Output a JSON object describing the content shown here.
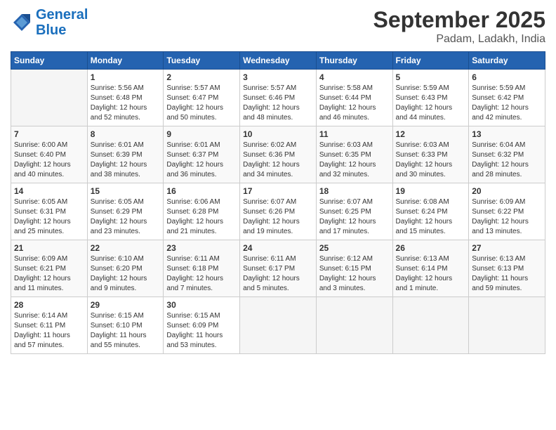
{
  "header": {
    "logo_line1": "General",
    "logo_line2": "Blue",
    "month": "September 2025",
    "location": "Padam, Ladakh, India"
  },
  "weekdays": [
    "Sunday",
    "Monday",
    "Tuesday",
    "Wednesday",
    "Thursday",
    "Friday",
    "Saturday"
  ],
  "weeks": [
    [
      {
        "day": "",
        "info": ""
      },
      {
        "day": "1",
        "info": "Sunrise: 5:56 AM\nSunset: 6:48 PM\nDaylight: 12 hours\nand 52 minutes."
      },
      {
        "day": "2",
        "info": "Sunrise: 5:57 AM\nSunset: 6:47 PM\nDaylight: 12 hours\nand 50 minutes."
      },
      {
        "day": "3",
        "info": "Sunrise: 5:57 AM\nSunset: 6:46 PM\nDaylight: 12 hours\nand 48 minutes."
      },
      {
        "day": "4",
        "info": "Sunrise: 5:58 AM\nSunset: 6:44 PM\nDaylight: 12 hours\nand 46 minutes."
      },
      {
        "day": "5",
        "info": "Sunrise: 5:59 AM\nSunset: 6:43 PM\nDaylight: 12 hours\nand 44 minutes."
      },
      {
        "day": "6",
        "info": "Sunrise: 5:59 AM\nSunset: 6:42 PM\nDaylight: 12 hours\nand 42 minutes."
      }
    ],
    [
      {
        "day": "7",
        "info": "Sunrise: 6:00 AM\nSunset: 6:40 PM\nDaylight: 12 hours\nand 40 minutes."
      },
      {
        "day": "8",
        "info": "Sunrise: 6:01 AM\nSunset: 6:39 PM\nDaylight: 12 hours\nand 38 minutes."
      },
      {
        "day": "9",
        "info": "Sunrise: 6:01 AM\nSunset: 6:37 PM\nDaylight: 12 hours\nand 36 minutes."
      },
      {
        "day": "10",
        "info": "Sunrise: 6:02 AM\nSunset: 6:36 PM\nDaylight: 12 hours\nand 34 minutes."
      },
      {
        "day": "11",
        "info": "Sunrise: 6:03 AM\nSunset: 6:35 PM\nDaylight: 12 hours\nand 32 minutes."
      },
      {
        "day": "12",
        "info": "Sunrise: 6:03 AM\nSunset: 6:33 PM\nDaylight: 12 hours\nand 30 minutes."
      },
      {
        "day": "13",
        "info": "Sunrise: 6:04 AM\nSunset: 6:32 PM\nDaylight: 12 hours\nand 28 minutes."
      }
    ],
    [
      {
        "day": "14",
        "info": "Sunrise: 6:05 AM\nSunset: 6:31 PM\nDaylight: 12 hours\nand 25 minutes."
      },
      {
        "day": "15",
        "info": "Sunrise: 6:05 AM\nSunset: 6:29 PM\nDaylight: 12 hours\nand 23 minutes."
      },
      {
        "day": "16",
        "info": "Sunrise: 6:06 AM\nSunset: 6:28 PM\nDaylight: 12 hours\nand 21 minutes."
      },
      {
        "day": "17",
        "info": "Sunrise: 6:07 AM\nSunset: 6:26 PM\nDaylight: 12 hours\nand 19 minutes."
      },
      {
        "day": "18",
        "info": "Sunrise: 6:07 AM\nSunset: 6:25 PM\nDaylight: 12 hours\nand 17 minutes."
      },
      {
        "day": "19",
        "info": "Sunrise: 6:08 AM\nSunset: 6:24 PM\nDaylight: 12 hours\nand 15 minutes."
      },
      {
        "day": "20",
        "info": "Sunrise: 6:09 AM\nSunset: 6:22 PM\nDaylight: 12 hours\nand 13 minutes."
      }
    ],
    [
      {
        "day": "21",
        "info": "Sunrise: 6:09 AM\nSunset: 6:21 PM\nDaylight: 12 hours\nand 11 minutes."
      },
      {
        "day": "22",
        "info": "Sunrise: 6:10 AM\nSunset: 6:20 PM\nDaylight: 12 hours\nand 9 minutes."
      },
      {
        "day": "23",
        "info": "Sunrise: 6:11 AM\nSunset: 6:18 PM\nDaylight: 12 hours\nand 7 minutes."
      },
      {
        "day": "24",
        "info": "Sunrise: 6:11 AM\nSunset: 6:17 PM\nDaylight: 12 hours\nand 5 minutes."
      },
      {
        "day": "25",
        "info": "Sunrise: 6:12 AM\nSunset: 6:15 PM\nDaylight: 12 hours\nand 3 minutes."
      },
      {
        "day": "26",
        "info": "Sunrise: 6:13 AM\nSunset: 6:14 PM\nDaylight: 12 hours\nand 1 minute."
      },
      {
        "day": "27",
        "info": "Sunrise: 6:13 AM\nSunset: 6:13 PM\nDaylight: 11 hours\nand 59 minutes."
      }
    ],
    [
      {
        "day": "28",
        "info": "Sunrise: 6:14 AM\nSunset: 6:11 PM\nDaylight: 11 hours\nand 57 minutes."
      },
      {
        "day": "29",
        "info": "Sunrise: 6:15 AM\nSunset: 6:10 PM\nDaylight: 11 hours\nand 55 minutes."
      },
      {
        "day": "30",
        "info": "Sunrise: 6:15 AM\nSunset: 6:09 PM\nDaylight: 11 hours\nand 53 minutes."
      },
      {
        "day": "",
        "info": ""
      },
      {
        "day": "",
        "info": ""
      },
      {
        "day": "",
        "info": ""
      },
      {
        "day": "",
        "info": ""
      }
    ]
  ]
}
